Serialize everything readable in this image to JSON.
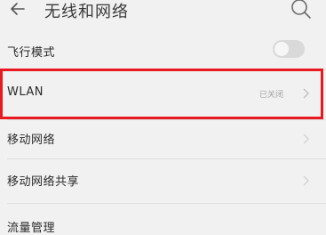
{
  "header": {
    "back_icon": "back-arrow-icon",
    "title": "无线和网络",
    "search_icon": "search-icon"
  },
  "settings": [
    {
      "id": "airplane",
      "label": "飞行模式",
      "control": "toggle",
      "on": false
    },
    {
      "id": "wlan",
      "label": "WLAN",
      "status": "已关闭",
      "control": "chevron"
    },
    {
      "id": "mobile",
      "label": "移动网络",
      "control": "chevron"
    },
    {
      "id": "hotspot",
      "label": "移动网络共享",
      "control": "chevron"
    },
    {
      "id": "partial",
      "label": "流量管理",
      "control": "chevron"
    }
  ],
  "colors": {
    "background": "#f1f1f1",
    "highlight_border": "#e8191f",
    "secondary_text": "#a4a4a4"
  }
}
